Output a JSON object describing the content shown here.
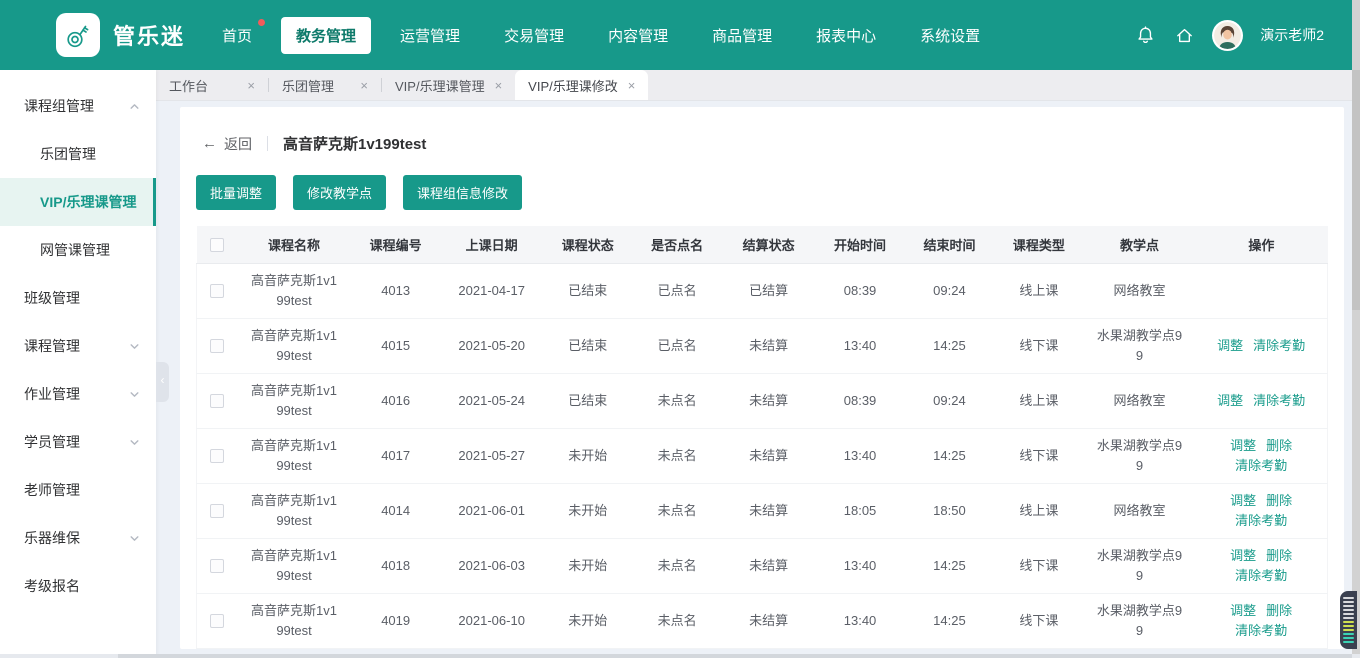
{
  "colors": {
    "primary": "#17998a",
    "primary_dark": "#0d7a6a",
    "link": "#1a9c8c",
    "badge": "#f25b5b"
  },
  "icons": {
    "back_arrow": "←",
    "tab_close": "×",
    "collapse_handle": "‹"
  },
  "brand": {
    "logo_text": "管乐迷"
  },
  "topnav": {
    "items": [
      {
        "label": "首页",
        "badge": true,
        "active": false
      },
      {
        "label": "教务管理",
        "badge": false,
        "active": true
      },
      {
        "label": "运营管理",
        "badge": false,
        "active": false
      },
      {
        "label": "交易管理",
        "badge": false,
        "active": false
      },
      {
        "label": "内容管理",
        "badge": false,
        "active": false
      },
      {
        "label": "商品管理",
        "badge": false,
        "active": false
      },
      {
        "label": "报表中心",
        "badge": false,
        "active": false
      },
      {
        "label": "系统设置",
        "badge": false,
        "active": false
      }
    ],
    "user": "演示老师2"
  },
  "sidebar": {
    "items": [
      {
        "label": "课程组管理",
        "level": "top",
        "chevron": "up",
        "active": false
      },
      {
        "label": "乐团管理",
        "level": "sub",
        "chevron": "none",
        "active": false
      },
      {
        "label": "VIP/乐理课管理",
        "level": "sub",
        "chevron": "none",
        "active": true
      },
      {
        "label": "网管课管理",
        "level": "sub",
        "chevron": "none",
        "active": false
      },
      {
        "label": "班级管理",
        "level": "top",
        "chevron": "none",
        "active": false
      },
      {
        "label": "课程管理",
        "level": "top",
        "chevron": "down",
        "active": false
      },
      {
        "label": "作业管理",
        "level": "top",
        "chevron": "down",
        "active": false
      },
      {
        "label": "学员管理",
        "level": "top",
        "chevron": "down",
        "active": false
      },
      {
        "label": "老师管理",
        "level": "top",
        "chevron": "none",
        "active": false
      },
      {
        "label": "乐器维保",
        "level": "top",
        "chevron": "down",
        "active": false
      },
      {
        "label": "考级报名",
        "level": "top",
        "chevron": "none",
        "active": false
      }
    ]
  },
  "tabs": [
    {
      "label": "工作台",
      "active": false
    },
    {
      "label": "乐团管理",
      "active": false
    },
    {
      "label": "VIP/乐理课管理",
      "active": false
    },
    {
      "label": "VIP/乐理课修改",
      "active": true
    }
  ],
  "page": {
    "back_label": "返回",
    "title": "高音萨克斯1v199test",
    "buttons": [
      "批量调整",
      "修改教学点",
      "课程组信息修改"
    ]
  },
  "table": {
    "columns": [
      "课程名称",
      "课程编号",
      "上课日期",
      "课程状态",
      "是否点名",
      "结算状态",
      "开始时间",
      "结束时间",
      "课程类型",
      "教学点",
      "操作"
    ],
    "rows": [
      {
        "course_name": "高音萨克斯1v199test",
        "course_no": "4013",
        "date": "2021-04-17",
        "status": "已结束",
        "rollcall": "已点名",
        "settle": "已结算",
        "start": "08:39",
        "end": "09:24",
        "type": "线上课",
        "location": "网络教室",
        "actions": []
      },
      {
        "course_name": "高音萨克斯1v199test",
        "course_no": "4015",
        "date": "2021-05-20",
        "status": "已结束",
        "rollcall": "已点名",
        "settle": "未结算",
        "start": "13:40",
        "end": "14:25",
        "type": "线下课",
        "location": "水果湖教学点99",
        "actions": [
          "调整",
          "清除考勤"
        ]
      },
      {
        "course_name": "高音萨克斯1v199test",
        "course_no": "4016",
        "date": "2021-05-24",
        "status": "已结束",
        "rollcall": "未点名",
        "settle": "未结算",
        "start": "08:39",
        "end": "09:24",
        "type": "线上课",
        "location": "网络教室",
        "actions": [
          "调整",
          "清除考勤"
        ]
      },
      {
        "course_name": "高音萨克斯1v199test",
        "course_no": "4017",
        "date": "2021-05-27",
        "status": "未开始",
        "rollcall": "未点名",
        "settle": "未结算",
        "start": "13:40",
        "end": "14:25",
        "type": "线下课",
        "location": "水果湖教学点99",
        "actions": [
          "调整",
          "删除",
          "清除考勤"
        ]
      },
      {
        "course_name": "高音萨克斯1v199test",
        "course_no": "4014",
        "date": "2021-06-01",
        "status": "未开始",
        "rollcall": "未点名",
        "settle": "未结算",
        "start": "18:05",
        "end": "18:50",
        "type": "线上课",
        "location": "网络教室",
        "actions": [
          "调整",
          "删除",
          "清除考勤"
        ]
      },
      {
        "course_name": "高音萨克斯1v199test",
        "course_no": "4018",
        "date": "2021-06-03",
        "status": "未开始",
        "rollcall": "未点名",
        "settle": "未结算",
        "start": "13:40",
        "end": "14:25",
        "type": "线下课",
        "location": "水果湖教学点99",
        "actions": [
          "调整",
          "删除",
          "清除考勤"
        ]
      },
      {
        "course_name": "高音萨克斯1v199test",
        "course_no": "4019",
        "date": "2021-06-10",
        "status": "未开始",
        "rollcall": "未点名",
        "settle": "未结算",
        "start": "13:40",
        "end": "14:25",
        "type": "线下课",
        "location": "水果湖教学点99",
        "actions": [
          "调整",
          "删除",
          "清除考勤"
        ]
      }
    ]
  }
}
